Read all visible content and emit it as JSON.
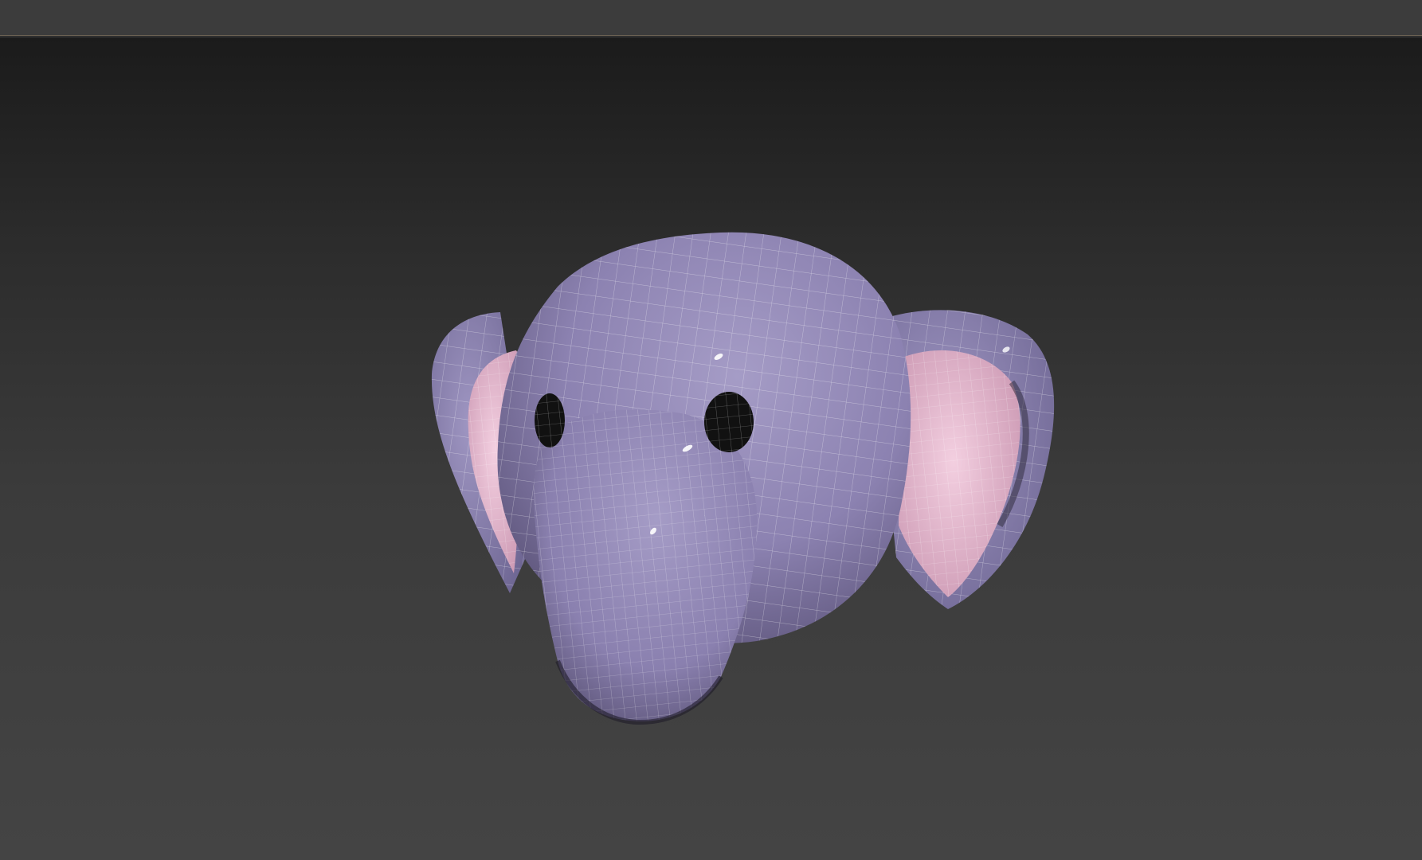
{
  "viewport": {
    "model": {
      "subject": "elephant-head",
      "body_color": "#8f84b3",
      "ear_inner_color": "#e6b6cf",
      "eye_color": "#111111",
      "wireframe_color": "#ffffff"
    }
  },
  "colors": {
    "top_bar": "#3c3c3c",
    "viewport_top": "#1b1b1b",
    "viewport_bottom": "#444444"
  }
}
